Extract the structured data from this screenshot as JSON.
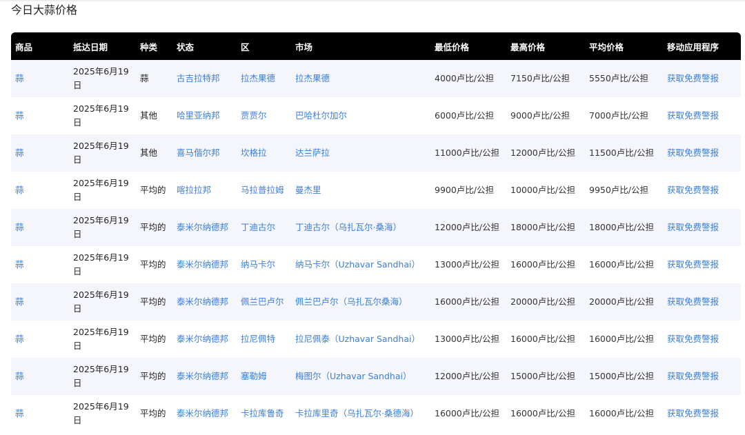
{
  "page": {
    "title": "今日大蒜价格"
  },
  "colors": {
    "header_bg": "#000000",
    "link": "#3b7ed8",
    "row_alt": "#f4f6fb"
  },
  "table": {
    "headers": [
      "商品",
      "抵达日期",
      "种类",
      "状态",
      "区",
      "市场",
      "最低价格",
      "最高价格",
      "平均价格",
      "移动应用程序"
    ],
    "rows": [
      {
        "commodity": "蒜",
        "date": "2025年6月19日",
        "variety": "蒜",
        "state": "古吉拉特邦",
        "district": "拉杰果德",
        "market": "拉杰果德",
        "min": "4000卢比/公担",
        "max": "7150卢比/公担",
        "avg": "5550卢比/公担",
        "app": "获取免费警报"
      },
      {
        "commodity": "蒜",
        "date": "2025年6月19日",
        "variety": "其他",
        "state": "哈里亚纳邦",
        "district": "贾贾尔",
        "market": "巴哈杜尔加尔",
        "min": "6000卢比/公担",
        "max": "9000卢比/公担",
        "avg": "7000卢比/公担",
        "app": "获取免费警报"
      },
      {
        "commodity": "蒜",
        "date": "2025年6月19日",
        "variety": "其他",
        "state": "喜马偕尔邦",
        "district": "坎格拉",
        "market": "达兰萨拉",
        "min": "11000卢比/公担",
        "max": "12000卢比/公担",
        "avg": "11500卢比/公担",
        "app": "获取免费警报"
      },
      {
        "commodity": "蒜",
        "date": "2025年6月19日",
        "variety": "平均的",
        "state": "喀拉拉邦",
        "district": "马拉普拉姆",
        "market": "曼杰里",
        "min": "9900卢比/公担",
        "max": "10000卢比/公担",
        "avg": "9950卢比/公担",
        "app": "获取免费警报"
      },
      {
        "commodity": "蒜",
        "date": "2025年6月19日",
        "variety": "平均的",
        "state": "泰米尔纳德邦",
        "district": "丁迪古尔",
        "market": "丁迪古尔（乌扎瓦尔·桑海）",
        "min": "12000卢比/公担",
        "max": "18000卢比/公担",
        "avg": "18000卢比/公担",
        "app": "获取免费警报"
      },
      {
        "commodity": "蒜",
        "date": "2025年6月19日",
        "variety": "平均的",
        "state": "泰米尔纳德邦",
        "district": "纳马卡尔",
        "market": "纳马卡尔（Uzhavar Sandhai）",
        "min": "13000卢比/公担",
        "max": "16000卢比/公担",
        "avg": "16000卢比/公担",
        "app": "获取免费警报"
      },
      {
        "commodity": "蒜",
        "date": "2025年6月19日",
        "variety": "平均的",
        "state": "泰米尔纳德邦",
        "district": "佩兰巴卢尔",
        "market": "佩兰巴卢尔（乌扎瓦尔桑海）",
        "min": "16000卢比/公担",
        "max": "20000卢比/公担",
        "avg": "20000卢比/公担",
        "app": "获取免费警报"
      },
      {
        "commodity": "蒜",
        "date": "2025年6月19日",
        "variety": "平均的",
        "state": "泰米尔纳德邦",
        "district": "拉尼佩特",
        "market": "拉尼佩泰（Uzhavar Sandhai）",
        "min": "13000卢比/公担",
        "max": "16000卢比/公担",
        "avg": "16000卢比/公担",
        "app": "获取免费警报"
      },
      {
        "commodity": "蒜",
        "date": "2025年6月19日",
        "variety": "平均的",
        "state": "泰米尔纳德邦",
        "district": "塞勒姆",
        "market": "梅图尔（Uzhavar Sandhai）",
        "min": "12000卢比/公担",
        "max": "15000卢比/公担",
        "avg": "15000卢比/公担",
        "app": "获取免费警报"
      },
      {
        "commodity": "蒜",
        "date": "2025年6月19日",
        "variety": "平均的",
        "state": "泰米尔纳德邦",
        "district": "卡拉库鲁奇",
        "market": "卡拉库里奇（乌扎瓦尔·桑德海）",
        "min": "16000卢比/公担",
        "max": "16000卢比/公担",
        "avg": "16000卢比/公担",
        "app": "获取免费警报"
      }
    ]
  }
}
